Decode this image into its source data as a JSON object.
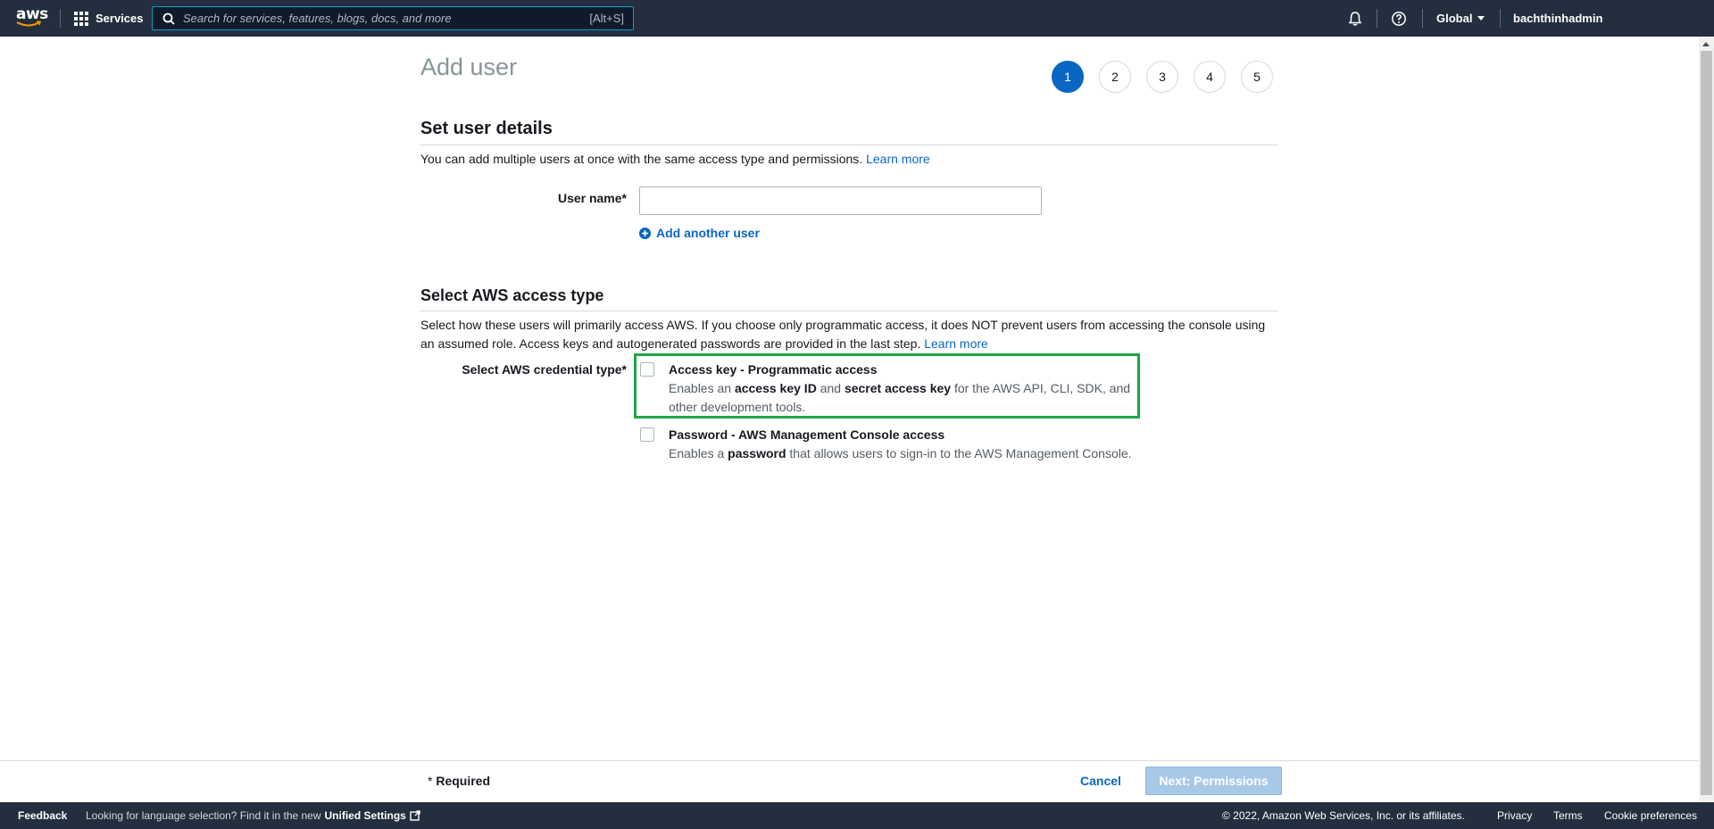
{
  "nav": {
    "logo_text": "aws",
    "services_label": "Services",
    "search_placeholder": "Search for services, features, blogs, docs, and more",
    "search_shortcut": "[Alt+S]",
    "region": "Global",
    "account": "bachthinhadmin"
  },
  "page": {
    "title": "Add user",
    "steps": [
      "1",
      "2",
      "3",
      "4",
      "5"
    ],
    "active_step": "1"
  },
  "user_details": {
    "section_title": "Set user details",
    "description": "You can add multiple users at once with the same access type and permissions.",
    "learn_more": "Learn more",
    "username_label": "User name*",
    "username_value": "",
    "add_another": "Add another user"
  },
  "access_type": {
    "section_title": "Select AWS access type",
    "description_line1": "Select how these users will primarily access AWS. If you choose only programmatic access, it does NOT prevent users from accessing the console using",
    "description_line2": "an assumed role. Access keys and autogenerated passwords are provided in the last step.",
    "learn_more": "Learn more",
    "credential_label": "Select AWS credential type*",
    "options": [
      {
        "title": "Access key - Programmatic access",
        "desc_prefix": "Enables an ",
        "desc_bold1": "access key ID",
        "desc_mid": " and ",
        "desc_bold2": "secret access key",
        "desc_suffix": " for the AWS API, CLI, SDK, and",
        "desc_line2": "other development tools."
      },
      {
        "title": "Password - AWS Management Console access",
        "desc_prefix": "Enables a ",
        "desc_bold1": "password",
        "desc_suffix": " that allows users to sign-in to the AWS Management Console."
      }
    ]
  },
  "footer_actions": {
    "required_star": "*",
    "required_text": " Required",
    "cancel": "Cancel",
    "next": "Next: Permissions"
  },
  "bottombar": {
    "feedback": "Feedback",
    "language_text": "Looking for language selection? Find it in the new",
    "unified_settings": "Unified Settings",
    "copyright": "© 2022, Amazon Web Services, Inc. or its affiliates.",
    "privacy": "Privacy",
    "terms": "Terms",
    "cookie": "Cookie preferences"
  },
  "colors": {
    "nav_bg": "#232f3e",
    "link": "#0a66c2",
    "highlight_border": "#1fa543",
    "next_button_disabled": "#a8c8e8"
  }
}
